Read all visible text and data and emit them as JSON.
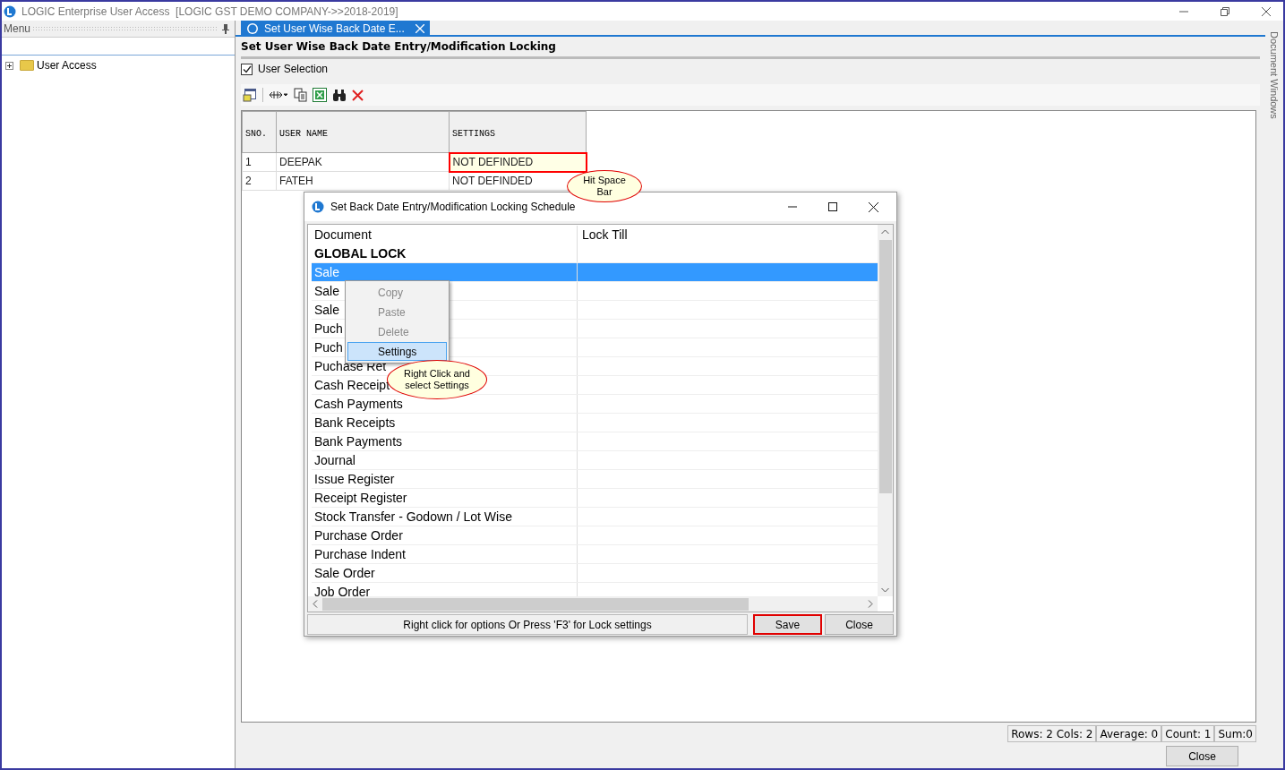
{
  "window": {
    "title": "LOGIC Enterprise User Access  [LOGIC GST DEMO COMPANY->>2018-2019]"
  },
  "menu_panel": {
    "title": "Menu",
    "tree": [
      {
        "label": "User Access",
        "expanded": false
      }
    ]
  },
  "tabs": [
    {
      "label": "Set User Wise Back Date E...",
      "selected": true
    }
  ],
  "page_title": "Set User Wise Back Date Entry/Modification Locking",
  "user_selection": {
    "label": "User Selection",
    "checked": true
  },
  "table": {
    "columns": [
      "SNO.",
      "USER NAME",
      "SETTINGS"
    ],
    "rows": [
      {
        "cells": [
          "1",
          "DEEPAK",
          "NOT DEFINDED"
        ],
        "highlighted": true
      },
      {
        "cells": [
          "2",
          "FATEH",
          "NOT DEFINDED"
        ],
        "highlighted": false
      }
    ]
  },
  "dialog": {
    "title": "Set Back Date Entry/Modification Locking Schedule",
    "columns": [
      "Document",
      "Lock Till"
    ],
    "rows": [
      {
        "document": "GLOBAL LOCK",
        "kind": "heading",
        "selected": false
      },
      {
        "document": "Sale",
        "kind": "item",
        "selected": true
      },
      {
        "document": "Sale",
        "kind": "item",
        "selected": false
      },
      {
        "document": "Sale",
        "kind": "item",
        "selected": false
      },
      {
        "document": "Puch",
        "kind": "item",
        "selected": false
      },
      {
        "document": "Puch",
        "kind": "item",
        "selected": false
      },
      {
        "document": "Puchase Ret",
        "kind": "item",
        "selected": false
      },
      {
        "document": "Cash Receipt",
        "kind": "item",
        "selected": false
      },
      {
        "document": "Cash Payments",
        "kind": "item",
        "selected": false
      },
      {
        "document": "Bank Receipts",
        "kind": "item",
        "selected": false
      },
      {
        "document": "Bank Payments",
        "kind": "item",
        "selected": false
      },
      {
        "document": "Journal",
        "kind": "item",
        "selected": false
      },
      {
        "document": "Issue Register",
        "kind": "item",
        "selected": false
      },
      {
        "document": "Receipt Register",
        "kind": "item",
        "selected": false
      },
      {
        "document": "Stock Transfer - Godown / Lot Wise",
        "kind": "item",
        "selected": false
      },
      {
        "document": "Purchase Order",
        "kind": "item",
        "selected": false
      },
      {
        "document": "Purchase Indent",
        "kind": "item",
        "selected": false
      },
      {
        "document": "Sale Order",
        "kind": "item",
        "selected": false
      },
      {
        "document": "Job Order",
        "kind": "item",
        "selected": false
      }
    ],
    "hint": "Right click for options Or Press 'F3' for Lock settings",
    "buttons": [
      {
        "label": "Save",
        "highlighted": true
      },
      {
        "label": "Close",
        "highlighted": false
      }
    ]
  },
  "context_menu": [
    {
      "label": "Copy",
      "disabled": true,
      "selected": false
    },
    {
      "label": "Paste",
      "disabled": true,
      "selected": false
    },
    {
      "label": "Delete",
      "disabled": true,
      "selected": false
    },
    {
      "label": "Settings",
      "disabled": false,
      "selected": true
    }
  ],
  "callouts": [
    {
      "text": "Hit Space Bar"
    },
    {
      "text": "Right Click and select Settings"
    }
  ],
  "status_bar": [
    "Rows: 2  Cols: 2",
    "Average: 0",
    "Count: 1",
    "Sum:0"
  ],
  "close_button": "Close",
  "side_tab": "Document Windows"
}
